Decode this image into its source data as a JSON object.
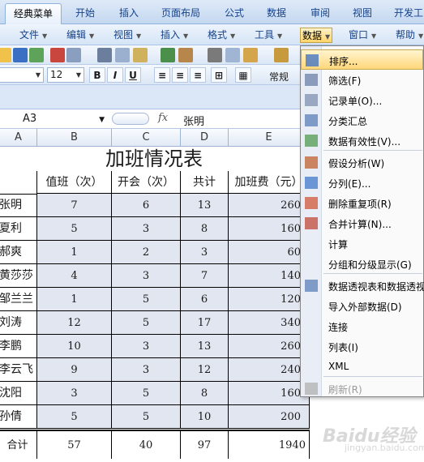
{
  "ribbon_tabs": [
    "经典菜单",
    "开始",
    "插入",
    "页面布局",
    "公式",
    "数据",
    "审阅",
    "视图",
    "开发工"
  ],
  "menu": [
    "文件",
    "编辑",
    "视图",
    "插入",
    "格式",
    "工具",
    "数据",
    "窗口",
    "帮助"
  ],
  "format_bar": {
    "font_size": "12",
    "style": "常规"
  },
  "formula_bar": {
    "name_box": "A3",
    "fx": "fx",
    "value": "张明"
  },
  "columns": [
    "A",
    "B",
    "C",
    "D",
    "E"
  ],
  "sheet": {
    "title": "加班情况表",
    "headers": [
      "值班（次）",
      "开会（次）",
      "共计",
      "加班费（元）"
    ],
    "rows": [
      {
        "name": "张明",
        "duty": "7",
        "meeting": "6",
        "total": "13",
        "fee": "260"
      },
      {
        "name": "夏利",
        "duty": "5",
        "meeting": "3",
        "total": "8",
        "fee": "160"
      },
      {
        "name": "郝爽",
        "duty": "1",
        "meeting": "2",
        "total": "3",
        "fee": "60"
      },
      {
        "name": "黄莎莎",
        "duty": "4",
        "meeting": "3",
        "total": "7",
        "fee": "140"
      },
      {
        "name": "邹兰兰",
        "duty": "1",
        "meeting": "5",
        "total": "6",
        "fee": "120"
      },
      {
        "name": "刘涛",
        "duty": "12",
        "meeting": "5",
        "total": "17",
        "fee": "340"
      },
      {
        "name": "李鹏",
        "duty": "10",
        "meeting": "3",
        "total": "13",
        "fee": "260"
      },
      {
        "name": "李云飞",
        "duty": "9",
        "meeting": "3",
        "total": "12",
        "fee": "240"
      },
      {
        "name": "沈阳",
        "duty": "3",
        "meeting": "5",
        "total": "8",
        "fee": "160"
      },
      {
        "name": "孙倩",
        "duty": "5",
        "meeting": "5",
        "total": "10",
        "fee": "200"
      }
    ],
    "sum": {
      "label": "合计",
      "duty": "57",
      "meeting": "40",
      "total": "97",
      "fee": "1940"
    }
  },
  "data_menu": [
    {
      "label": "排序...",
      "icon": "sort-icon",
      "highlight": true
    },
    {
      "label": "筛选(F)",
      "icon": "filter-icon"
    },
    {
      "label": "记录单(O)...",
      "icon": "form-icon"
    },
    {
      "label": "分类汇总",
      "icon": "subtotal-icon"
    },
    {
      "label": "数据有效性(V)...",
      "icon": "validation-icon"
    },
    {
      "label": "假设分析(W)",
      "icon": "whatif-icon"
    },
    {
      "label": "分列(E)...",
      "icon": "text-to-columns-icon"
    },
    {
      "label": "删除重复项(R)",
      "icon": "remove-duplicates-icon"
    },
    {
      "label": "合并计算(N)...",
      "icon": "consolidate-icon"
    },
    {
      "label": "计算",
      "icon": ""
    },
    {
      "label": "分组和分级显示(G)",
      "icon": ""
    },
    {
      "label": "数据透视表和数据透视",
      "icon": "pivot-table-icon"
    },
    {
      "label": "导入外部数据(D)",
      "icon": ""
    },
    {
      "label": "连接",
      "icon": ""
    },
    {
      "label": "列表(I)",
      "icon": ""
    },
    {
      "label": "XML",
      "icon": ""
    },
    {
      "label": "刷新(R)",
      "icon": "refresh-icon",
      "disabled": true
    }
  ],
  "watermark": {
    "brand": "Baidu经验",
    "sub": "jingyan.baidu.com"
  },
  "colors": {
    "accent": "#15428b",
    "highlight": "#ffd77a",
    "selection": "#e1e6f0"
  }
}
